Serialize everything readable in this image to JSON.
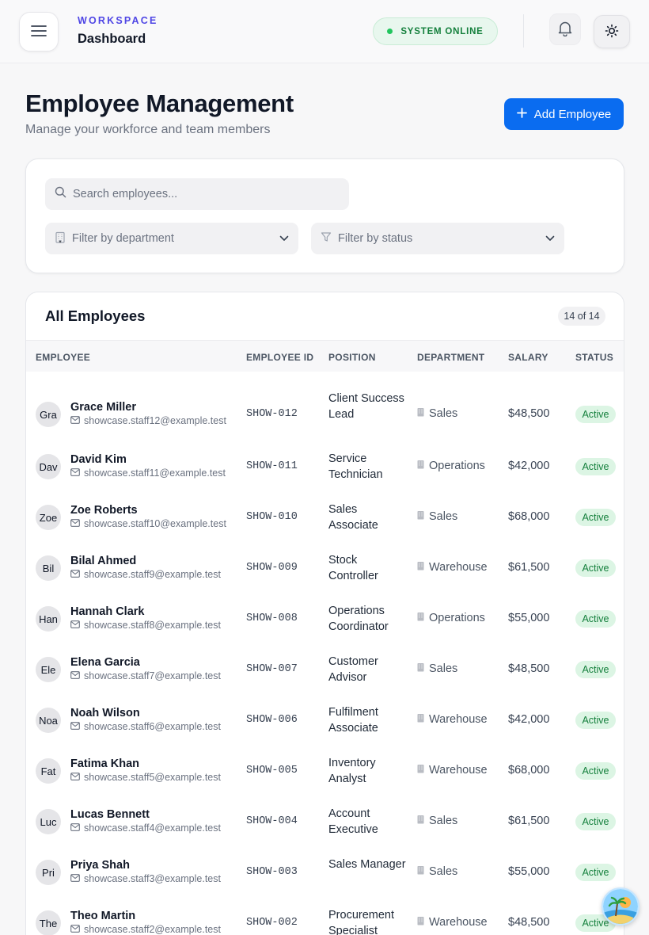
{
  "header": {
    "workspace_label": "WORKSPACE",
    "workspace_title": "Dashboard",
    "status_text": "SYSTEM ONLINE"
  },
  "page": {
    "title": "Employee Management",
    "subtitle": "Manage your workforce and team members",
    "add_button": "Add Employee"
  },
  "filters": {
    "search_placeholder": "Search employees...",
    "department_placeholder": "Filter by department",
    "status_placeholder": "Filter by status"
  },
  "table": {
    "title": "All Employees",
    "count": "14 of 14",
    "columns": [
      "EMPLOYEE",
      "EMPLOYEE ID",
      "POSITION",
      "DEPARTMENT",
      "SALARY",
      "STATUS"
    ],
    "rows": [
      {
        "initials": "Gra",
        "name": "Grace Miller",
        "email": "showcase.staff12@example.test",
        "id": "SHOW-012",
        "position": "Client Success Lead",
        "department": "Sales",
        "salary": "$48,500",
        "status": "Active"
      },
      {
        "initials": "Dav",
        "name": "David Kim",
        "email": "showcase.staff11@example.test",
        "id": "SHOW-011",
        "position": "Service Technician",
        "department": "Operations",
        "salary": "$42,000",
        "status": "Active"
      },
      {
        "initials": "Zoe",
        "name": "Zoe Roberts",
        "email": "showcase.staff10@example.test",
        "id": "SHOW-010",
        "position": "Sales Associate",
        "department": "Sales",
        "salary": "$68,000",
        "status": "Active"
      },
      {
        "initials": "Bil",
        "name": "Bilal Ahmed",
        "email": "showcase.staff9@example.test",
        "id": "SHOW-009",
        "position": "Stock Controller",
        "department": "Warehouse",
        "salary": "$61,500",
        "status": "Active"
      },
      {
        "initials": "Han",
        "name": "Hannah Clark",
        "email": "showcase.staff8@example.test",
        "id": "SHOW-008",
        "position": "Operations Coordinator",
        "department": "Operations",
        "salary": "$55,000",
        "status": "Active"
      },
      {
        "initials": "Ele",
        "name": "Elena Garcia",
        "email": "showcase.staff7@example.test",
        "id": "SHOW-007",
        "position": "Customer Advisor",
        "department": "Sales",
        "salary": "$48,500",
        "status": "Active"
      },
      {
        "initials": "Noa",
        "name": "Noah Wilson",
        "email": "showcase.staff6@example.test",
        "id": "SHOW-006",
        "position": "Fulfilment Associate",
        "department": "Warehouse",
        "salary": "$42,000",
        "status": "Active"
      },
      {
        "initials": "Fat",
        "name": "Fatima Khan",
        "email": "showcase.staff5@example.test",
        "id": "SHOW-005",
        "position": "Inventory Analyst",
        "department": "Warehouse",
        "salary": "$68,000",
        "status": "Active"
      },
      {
        "initials": "Luc",
        "name": "Lucas Bennett",
        "email": "showcase.staff4@example.test",
        "id": "SHOW-004",
        "position": "Account Executive",
        "department": "Sales",
        "salary": "$61,500",
        "status": "Active"
      },
      {
        "initials": "Pri",
        "name": "Priya Shah",
        "email": "showcase.staff3@example.test",
        "id": "SHOW-003",
        "position": "Sales Manager",
        "department": "Sales",
        "salary": "$55,000",
        "status": "Active"
      },
      {
        "initials": "The",
        "name": "Theo Martin",
        "email": "showcase.staff2@example.test",
        "id": "SHOW-002",
        "position": "Procurement Specialist",
        "department": "Warehouse",
        "salary": "$48,500",
        "status": "Active"
      }
    ]
  },
  "colors": {
    "accent": "#4f46e5",
    "primary_button": "#0a6cf0",
    "online_green": "#15803d",
    "active_badge_bg": "#dcf5e4"
  },
  "icons": {
    "menu": "menu-icon",
    "bell": "bell-icon",
    "theme": "sun-icon",
    "add": "plus-icon",
    "search": "search-icon",
    "department": "building-icon",
    "status": "filter-icon",
    "chevron": "chevron-down-icon",
    "email": "mail-icon",
    "assistant": "assistant-avatar-icon"
  }
}
